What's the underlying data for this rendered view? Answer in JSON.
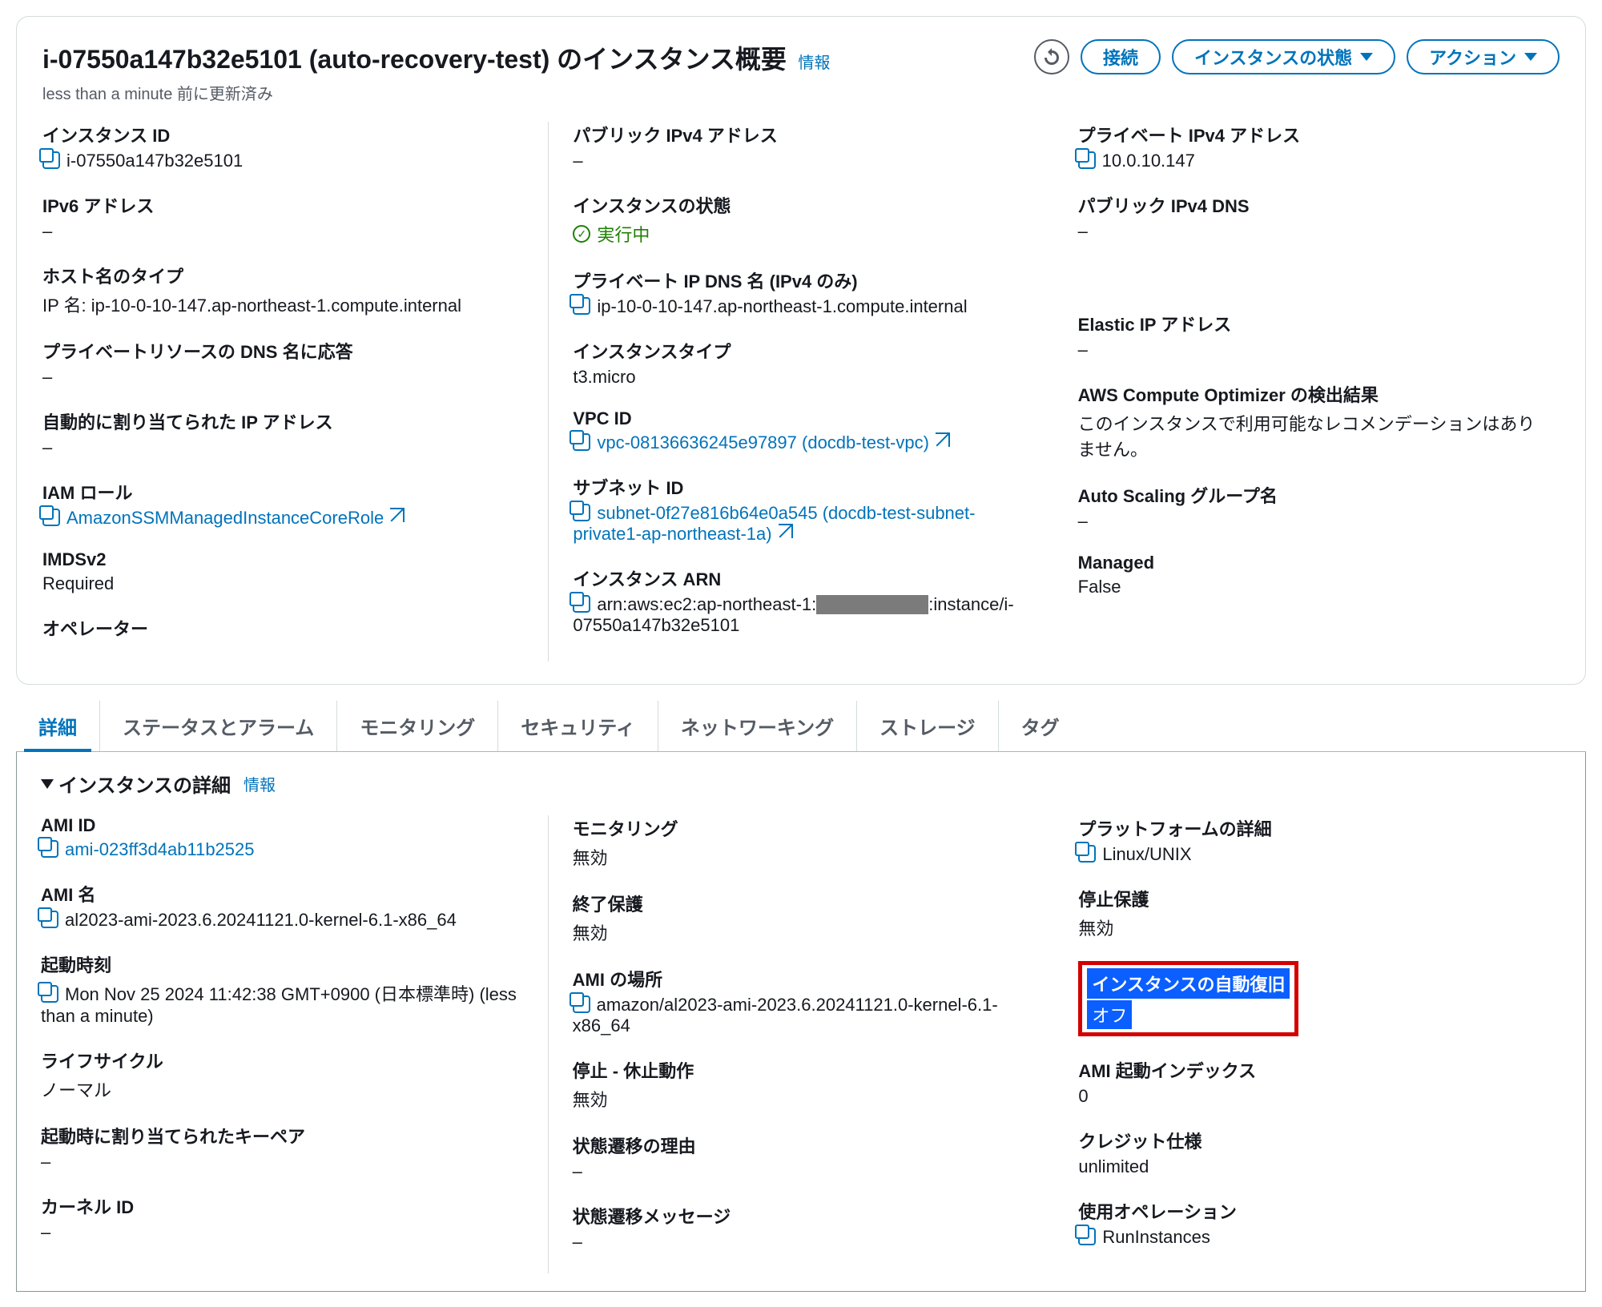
{
  "header": {
    "title": "i-07550a147b32e5101 (auto-recovery-test) のインスタンス概要",
    "info": "情報",
    "updated": "less than a minute 前に更新済み",
    "connect": "接続",
    "state": "インスタンスの状態",
    "actions": "アクション"
  },
  "summary": {
    "col1": [
      {
        "label": "インスタンス ID",
        "value": "i-07550a147b32e5101",
        "copy": true
      },
      {
        "label": "IPv6 アドレス",
        "value": "–"
      },
      {
        "label": "ホスト名のタイプ",
        "value": "IP 名: ip-10-0-10-147.ap-northeast-1.compute.internal"
      },
      {
        "label": "プライベートリソースの DNS 名に応答",
        "value": "–"
      },
      {
        "label": "自動的に割り当てられた IP アドレス",
        "value": "–"
      },
      {
        "label": "IAM ロール",
        "value": "AmazonSSMManagedInstanceCoreRole",
        "copy": true,
        "link": true,
        "ext": true
      },
      {
        "label": "IMDSv2",
        "value": "Required"
      },
      {
        "label": "オペレーター",
        "value": ""
      }
    ],
    "col2": [
      {
        "label": "パブリック IPv4 アドレス",
        "value": "–"
      },
      {
        "label": "インスタンスの状態",
        "status": "実行中"
      },
      {
        "label": "プライベート IP DNS 名 (IPv4 のみ)",
        "value": "ip-10-0-10-147.ap-northeast-1.compute.internal",
        "copy": true
      },
      {
        "label": "インスタンスタイプ",
        "value": "t3.micro"
      },
      {
        "label": "VPC ID",
        "value": "vpc-08136636245e97897 (docdb-test-vpc)",
        "copy": true,
        "link": true,
        "ext": true
      },
      {
        "label": "サブネット ID",
        "value": "subnet-0f27e816b64e0a545 (docdb-test-subnet-private1-ap-northeast-1a)",
        "copy": true,
        "link": true,
        "ext": true
      },
      {
        "label": "インスタンス ARN",
        "arn_prefix": "arn:aws:ec2:ap-northeast-1:",
        "arn_suffix": ":instance/i-07550a147b32e5101",
        "copy": true
      }
    ],
    "col3": [
      {
        "label": "プライベート IPv4 アドレス",
        "value": "10.0.10.147",
        "copy": true
      },
      {
        "label": "パブリック IPv4 DNS",
        "value": "–"
      },
      {
        "label": "",
        "value": ""
      },
      {
        "label": "Elastic IP アドレス",
        "value": "–"
      },
      {
        "label": "AWS Compute Optimizer の検出結果",
        "value": "このインスタンスで利用可能なレコメンデーションはありません。"
      },
      {
        "label": "Auto Scaling グループ名",
        "value": "–"
      },
      {
        "label": "Managed",
        "value": "False"
      }
    ]
  },
  "tabs": [
    "詳細",
    "ステータスとアラーム",
    "モニタリング",
    "セキュリティ",
    "ネットワーキング",
    "ストレージ",
    "タグ"
  ],
  "details": {
    "heading": "インスタンスの詳細",
    "info": "情報",
    "col1": [
      {
        "label": "AMI ID",
        "value": "ami-023ff3d4ab11b2525",
        "copy": true,
        "link": true
      },
      {
        "label": "AMI 名",
        "value": "al2023-ami-2023.6.20241121.0-kernel-6.1-x86_64",
        "copy": true
      },
      {
        "label": "起動時刻",
        "value": "Mon Nov 25 2024 11:42:38 GMT+0900 (日本標準時) (less than a minute)",
        "copy": true
      },
      {
        "label": "ライフサイクル",
        "value": "ノーマル"
      },
      {
        "label": "起動時に割り当てられたキーペア",
        "value": "–"
      },
      {
        "label": "カーネル ID",
        "value": "–"
      }
    ],
    "col2": [
      {
        "label": "モニタリング",
        "value": "無効"
      },
      {
        "label": "終了保護",
        "value": "無効"
      },
      {
        "label": "AMI の場所",
        "value": "amazon/al2023-ami-2023.6.20241121.0-kernel-6.1-x86_64",
        "copy": true
      },
      {
        "label": "停止 - 休止動作",
        "value": "無効"
      },
      {
        "label": "状態遷移の理由",
        "value": "–"
      },
      {
        "label": "状態遷移メッセージ",
        "value": "–"
      }
    ],
    "col3": [
      {
        "label": "プラットフォームの詳細",
        "value": "Linux/UNIX",
        "copy": true
      },
      {
        "label": "停止保護",
        "value": "無効"
      },
      {
        "label": "インスタンスの自動復旧",
        "value": "オフ",
        "highlight": true
      },
      {
        "label": "AMI 起動インデックス",
        "value": "0"
      },
      {
        "label": "クレジット仕様",
        "value": "unlimited"
      },
      {
        "label": "使用オペレーション",
        "value": "RunInstances",
        "copy": true
      }
    ]
  }
}
